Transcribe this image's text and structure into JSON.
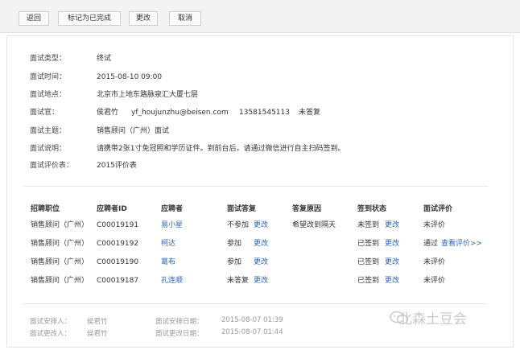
{
  "toolbar": {
    "back": "返回",
    "mark_done": "标记为已完成",
    "edit": "更改",
    "cancel": "取消"
  },
  "details": [
    {
      "label": "面试类型：",
      "value": "终试"
    },
    {
      "label": "面试时间：",
      "value": "2015-08-10 09:00"
    },
    {
      "label": "面试地点：",
      "value": "北京市上地东路脉泉汇大厦七层"
    },
    {
      "label": "面试官：",
      "value": "侯君竹"
    },
    {
      "label": "面试主题：",
      "value": "销售顾问（广州）面试"
    },
    {
      "label": "面试说明：",
      "value": "请携带2张1寸免冠照和学历证件。到前台后，请通过微信进行自主扫码签到。"
    },
    {
      "label": "面试评价表：",
      "value": "2015评价表"
    }
  ],
  "interviewer": {
    "email": "yf_houjunzhu@beisen.com",
    "phone": "13581545113",
    "status": "未答复"
  },
  "table": {
    "headers": [
      "招聘职位",
      "应聘者ID",
      "应聘者",
      "面试答复",
      "答复原因",
      "签到状态",
      "面试评价"
    ],
    "rows": [
      {
        "position": "销售顾问（广州）",
        "id": "C00019191",
        "name": "易小星",
        "reply": "不参加",
        "reply_link": "更改",
        "reason": "希望改到隔天",
        "checkin": "未签到",
        "checkin_link": "更改",
        "eval": "未评价",
        "eval_link": ""
      },
      {
        "position": "销售顾问（广州）",
        "id": "C00019192",
        "name": "柯达",
        "reply": "参加",
        "reply_link": "更改",
        "reason": "",
        "checkin": "已签到",
        "checkin_link": "更改",
        "eval": "通过",
        "eval_link": "查看评价>>"
      },
      {
        "position": "销售顾问（广州）",
        "id": "C00019190",
        "name": "葛布",
        "reply": "参加",
        "reply_link": "更改",
        "reason": "",
        "checkin": "已签到",
        "checkin_link": "更改",
        "eval": "未评价",
        "eval_link": ""
      },
      {
        "position": "销售顾问（广州）",
        "id": "C00019187",
        "name": "孔连顺",
        "reply": "未答复",
        "reply_link": "更改",
        "reason": "",
        "checkin": "已签到",
        "checkin_link": "更改",
        "eval": "未评价",
        "eval_link": ""
      }
    ]
  },
  "footer": {
    "arranger_label": "面试安排人：",
    "arranger": "侯君竹",
    "arrange_date_label": "面试安排日期：",
    "arrange_date": "2015-08-07 01:39",
    "modifier_label": "面试更改人：",
    "modifier": "侯君竹",
    "modify_date_label": "面试更改日期：",
    "modify_date": "2015-08-07 01:44"
  },
  "watermark": {
    "text": "北森土豆会",
    "icon": "wechat-icon"
  },
  "colors": {
    "link": "#2a66b8",
    "toolbar_bg": "#f3f3f3",
    "muted": "#9a9a9a"
  }
}
